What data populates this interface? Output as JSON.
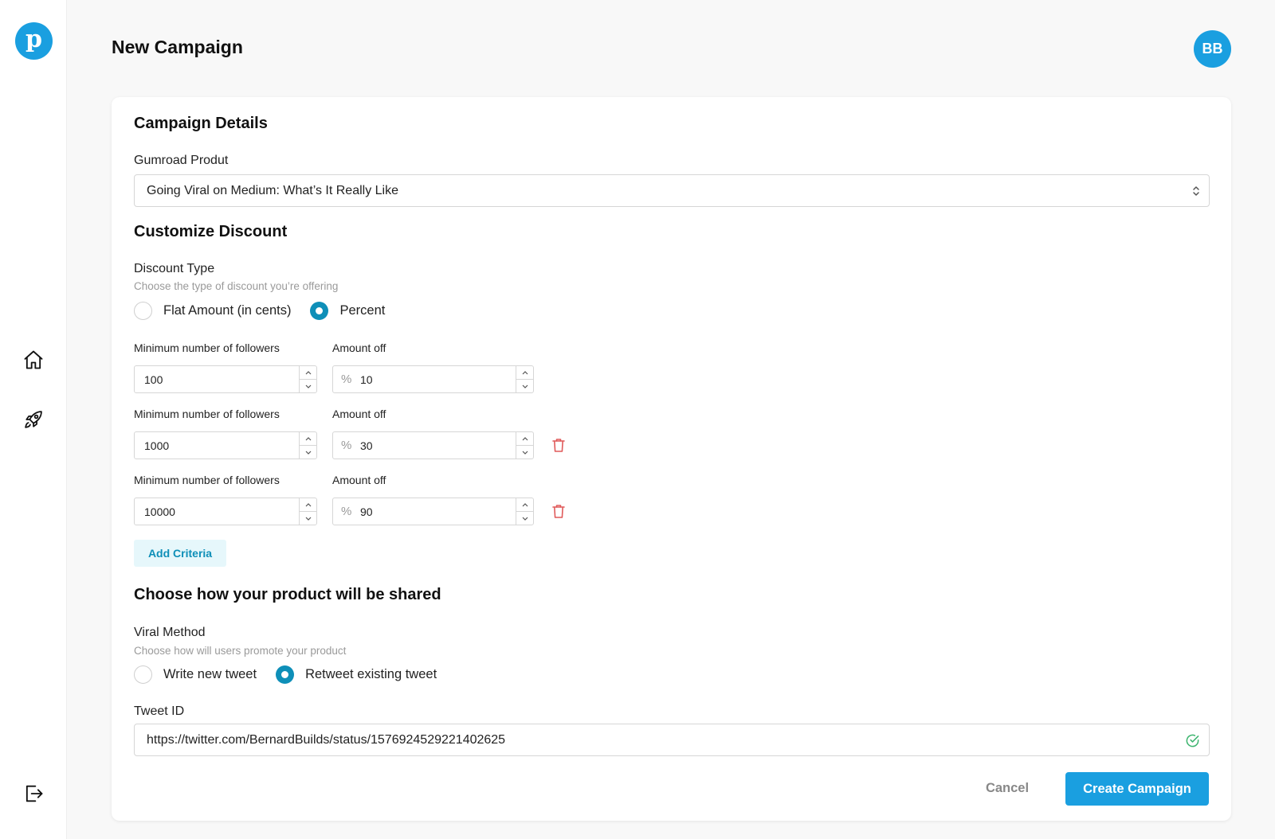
{
  "app": {
    "logo_letter": "p",
    "brand_color": "#1a9fe0",
    "accent_color": "#0e8fb8",
    "danger_color": "#e05a5a",
    "success_color": "#3cb46e"
  },
  "sidebar": {
    "items": [
      {
        "name": "home",
        "icon": "home-icon"
      },
      {
        "name": "campaigns",
        "icon": "rocket-icon"
      },
      {
        "name": "logout",
        "icon": "logout-icon"
      }
    ]
  },
  "header": {
    "title": "New Campaign",
    "avatar_initials": "BB"
  },
  "campaign_details": {
    "heading": "Campaign Details",
    "product_label": "Gumroad Produt",
    "product_value": "Going Viral on Medium: What’s It Really Like"
  },
  "discount": {
    "heading": "Customize Discount",
    "type_label": "Discount Type",
    "type_help": "Choose the type of discount you’re offering",
    "options": [
      {
        "label": "Flat Amount (in cents)",
        "selected": false
      },
      {
        "label": "Percent",
        "selected": true
      }
    ],
    "followers_label": "Minimum number of followers",
    "amount_label": "Amount off",
    "amount_prefix": "%",
    "criteria": [
      {
        "followers": "100",
        "amount": "10",
        "deletable": false
      },
      {
        "followers": "1000",
        "amount": "30",
        "deletable": true
      },
      {
        "followers": "10000",
        "amount": "90",
        "deletable": true
      }
    ],
    "add_label": "Add Criteria"
  },
  "sharing": {
    "heading": "Choose how your product will be shared",
    "method_label": "Viral Method",
    "method_help": "Choose how will users promote your product",
    "options": [
      {
        "label": "Write new tweet",
        "selected": false
      },
      {
        "label": "Retweet existing tweet",
        "selected": true
      }
    ],
    "tweet_label": "Tweet ID",
    "tweet_value": "https://twitter.com/BernardBuilds/status/1576924529221402625"
  },
  "actions": {
    "cancel_label": "Cancel",
    "create_label": "Create Campaign"
  }
}
